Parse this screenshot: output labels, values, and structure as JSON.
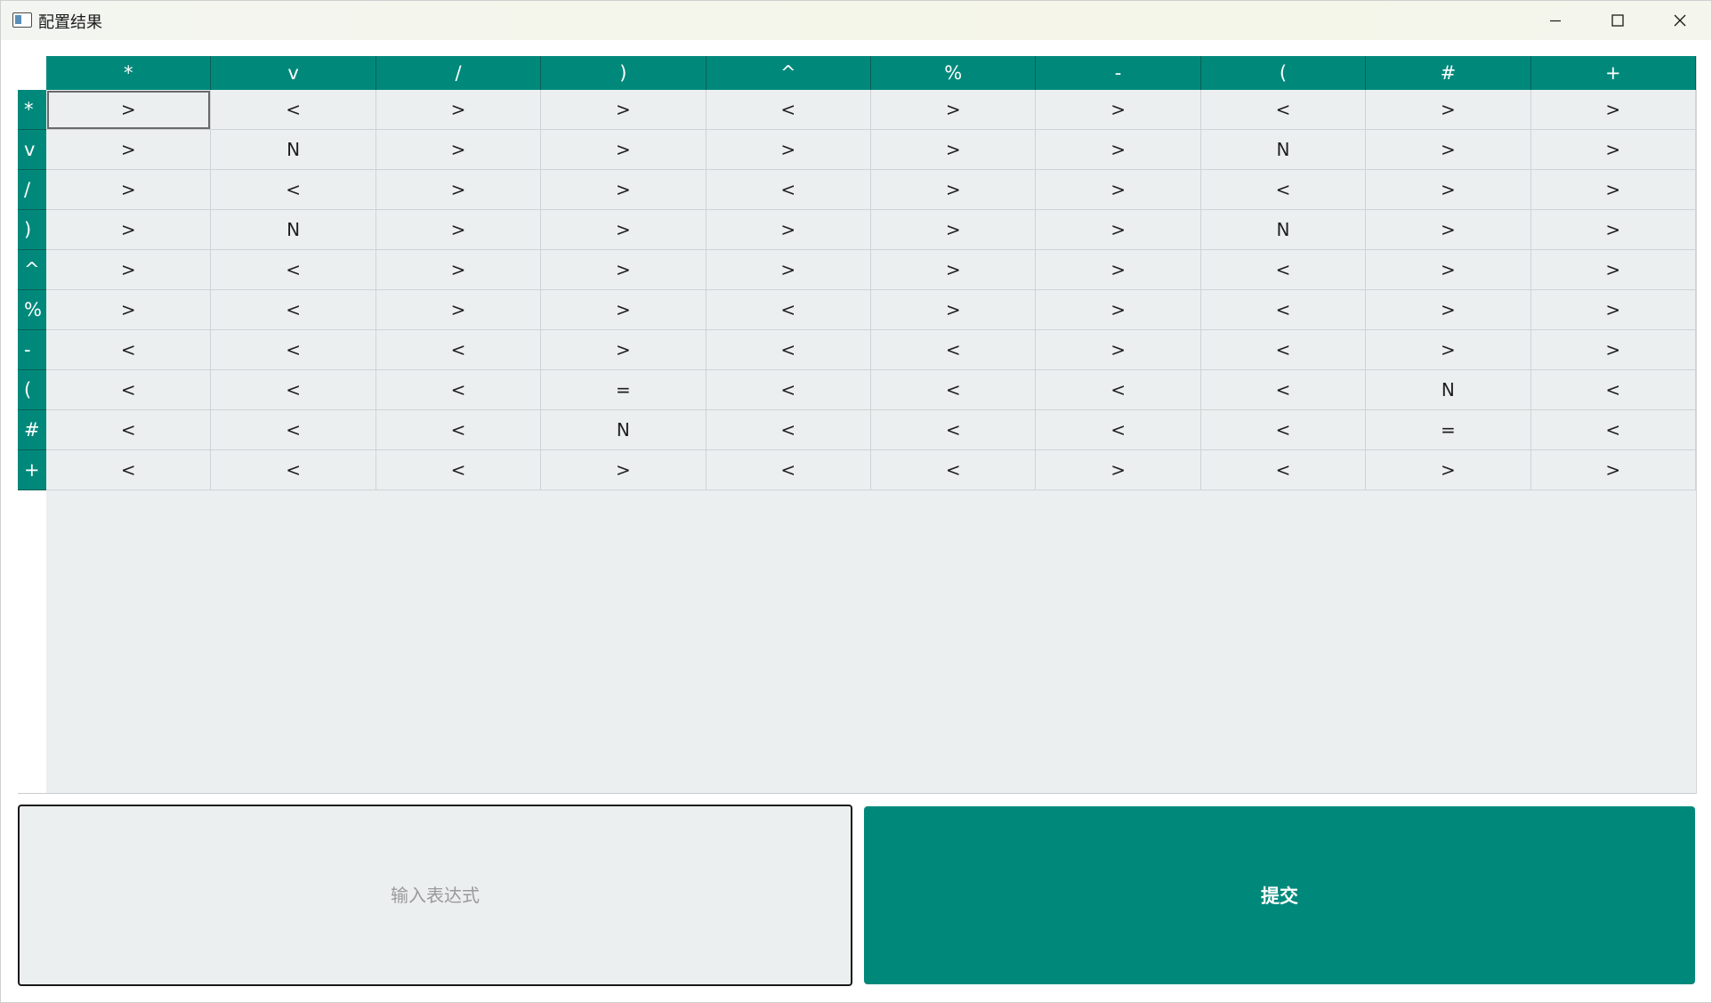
{
  "window": {
    "title": "配置结果",
    "icons": {
      "app": "window-app-icon",
      "minimize": "minimize-icon",
      "maximize": "maximize-icon",
      "close": "close-icon"
    }
  },
  "table": {
    "columns": [
      "*",
      "v",
      "/",
      ")",
      "^",
      "%",
      "-",
      "(",
      "#",
      "+"
    ],
    "rows": [
      {
        "label": "*",
        "cells": [
          ">",
          "<",
          ">",
          ">",
          "<",
          ">",
          ">",
          "<",
          ">",
          ">"
        ]
      },
      {
        "label": "v",
        "cells": [
          ">",
          "N",
          ">",
          ">",
          ">",
          ">",
          ">",
          "N",
          ">",
          ">"
        ]
      },
      {
        "label": "/",
        "cells": [
          ">",
          "<",
          ">",
          ">",
          "<",
          ">",
          ">",
          "<",
          ">",
          ">"
        ]
      },
      {
        "label": ")",
        "cells": [
          ">",
          "N",
          ">",
          ">",
          ">",
          ">",
          ">",
          "N",
          ">",
          ">"
        ]
      },
      {
        "label": "^",
        "cells": [
          ">",
          "<",
          ">",
          ">",
          ">",
          ">",
          ">",
          "<",
          ">",
          ">"
        ]
      },
      {
        "label": "%",
        "cells": [
          ">",
          "<",
          ">",
          ">",
          "<",
          ">",
          ">",
          "<",
          ">",
          ">"
        ]
      },
      {
        "label": "-",
        "cells": [
          "<",
          "<",
          "<",
          ">",
          "<",
          "<",
          ">",
          "<",
          ">",
          ">"
        ]
      },
      {
        "label": "(",
        "cells": [
          "<",
          "<",
          "<",
          "=",
          "<",
          "<",
          "<",
          "<",
          "N",
          "<"
        ]
      },
      {
        "label": "#",
        "cells": [
          "<",
          "<",
          "<",
          "N",
          "<",
          "<",
          "<",
          "<",
          "=",
          "<"
        ]
      },
      {
        "label": "+",
        "cells": [
          "<",
          "<",
          "<",
          ">",
          "<",
          "<",
          ">",
          "<",
          ">",
          ">"
        ]
      }
    ],
    "selected_cell": {
      "row": 0,
      "col": 0
    }
  },
  "expression_input": {
    "placeholder": "输入表达式",
    "value": ""
  },
  "submit_button": {
    "label": "提交"
  },
  "colors": {
    "accent": "#00897b",
    "grid_bg": "#eceff0"
  }
}
